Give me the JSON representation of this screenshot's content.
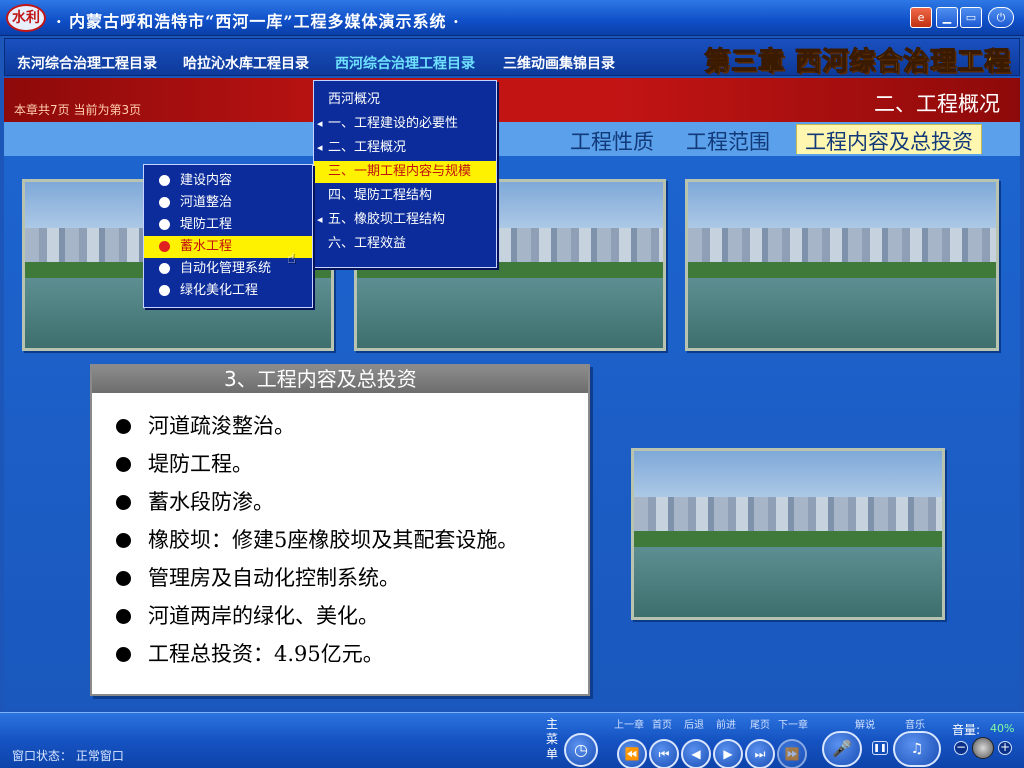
{
  "app": {
    "title": "· 内蒙古呼和浩特市“西河一库”工程多媒体演示系统 ·",
    "logo_text": "水利"
  },
  "chapter_nav": {
    "items": [
      "东河综合治理工程目录",
      "哈拉沁水库工程目录",
      "西河综合治理工程目录",
      "三维动画集锦目录"
    ],
    "active_index": 2,
    "chapter_title": "第三章  西河综合治理工程"
  },
  "status": {
    "page_info": "本章共7页  当前为第3页",
    "section_title": "二、工程概况"
  },
  "tabs": {
    "items": [
      "工程性质",
      "工程范围",
      "工程内容及总投资"
    ],
    "active_index": 2
  },
  "section_menu": {
    "items": [
      {
        "label": "西河概况",
        "has_sub": false
      },
      {
        "label": "一、工程建设的必要性",
        "has_sub": true
      },
      {
        "label": "二、工程概况",
        "has_sub": true
      },
      {
        "label": "三、一期工程内容与规模",
        "has_sub": false,
        "active": true
      },
      {
        "label": "四、堤防工程结构",
        "has_sub": false
      },
      {
        "label": "五、橡胶坝工程结构",
        "has_sub": true
      },
      {
        "label": "六、工程效益",
        "has_sub": false
      }
    ]
  },
  "sub_menu": {
    "items": [
      "建设内容",
      "河道整治",
      "堤防工程",
      "蓄水工程",
      "自动化管理系统",
      "绿化美化工程"
    ],
    "active_index": 3
  },
  "info_box": {
    "header": "3、工程内容及总投资",
    "items": [
      "河道疏浚整治。",
      "堤防工程。",
      "蓄水段防渗。",
      "橡胶坝：修建5座橡胶坝及其配套设施。",
      "管理房及自动化控制系统。",
      "河道两岸的绿化、美化。",
      "工程总投资：4.95亿元。"
    ]
  },
  "bottom_bar": {
    "window_status": "窗口状态： 正常窗口",
    "main_menu": "主菜单",
    "nav_labels": [
      "上一章",
      "首页",
      "后退",
      "前进",
      "尾页",
      "下一章"
    ],
    "explain": "解说",
    "music": "音乐",
    "volume_label": "音量:",
    "volume_value": "40%"
  },
  "colors": {
    "accent_yellow": "#fff200",
    "chapter_title": "#ffd21a",
    "status_red": "#c31414",
    "bg_blue": "#1b56b8"
  }
}
